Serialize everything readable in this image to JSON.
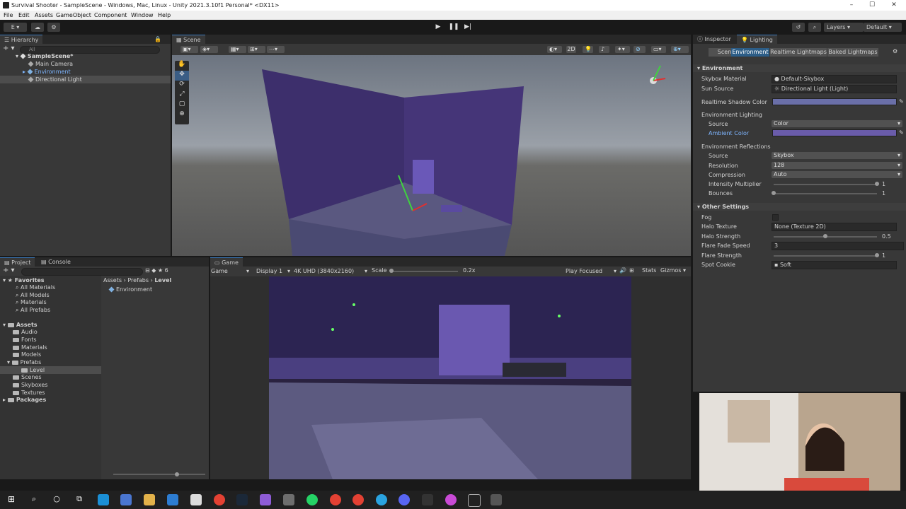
{
  "window": {
    "title": "Survival Shooter - SampleScene - Windows, Mac, Linux - Unity 2021.3.10f1 Personal* <DX11>"
  },
  "menu": [
    "File",
    "Edit",
    "Assets",
    "GameObject",
    "Component",
    "Window",
    "Help"
  ],
  "toolbar": {
    "account_label": "E",
    "layers_label": "Layers",
    "layout_label": "Default"
  },
  "hierarchy": {
    "tab": "Hierarchy",
    "search_placeholder": "All",
    "items": [
      {
        "label": "SampleScene*",
        "level": 0
      },
      {
        "label": "Main Camera",
        "level": 1
      },
      {
        "label": "Environment",
        "level": 1
      },
      {
        "label": "Directional Light",
        "level": 1
      }
    ]
  },
  "scene": {
    "tab": "Scene",
    "mode_2d": "2D"
  },
  "game": {
    "tab": "Game",
    "mode": "Game",
    "display": "Display 1",
    "resolution": "4K UHD (3840x2160)",
    "scale_label": "Scale",
    "scale_value": "0.2x",
    "play_focus": "Play Focused",
    "stats": "Stats",
    "gizmos": "Gizmos"
  },
  "project": {
    "tabs": [
      "Project",
      "Console"
    ],
    "hidden_count": "6",
    "breadcrumb": [
      "Assets",
      "Prefabs",
      "Level"
    ],
    "favorites_label": "Favorites",
    "favorites": [
      "All Materials",
      "All Models",
      "Materials",
      "All Prefabs"
    ],
    "assets_label": "Assets",
    "folders": [
      "Audio",
      "Fonts",
      "Materials",
      "Models",
      "Prefabs",
      "Level",
      "Scenes",
      "Skyboxes",
      "Textures"
    ],
    "packages_label": "Packages",
    "content_items": [
      "Environment"
    ]
  },
  "inspector": {
    "tabs": [
      "Inspector",
      "Lighting"
    ],
    "subtabs": [
      "Scene",
      "Environment",
      "Realtime Lightmaps",
      "Baked Lightmaps"
    ],
    "environment_header": "Environment",
    "skybox_label": "Skybox Material",
    "skybox_value": "Default-Skybox",
    "sun_label": "Sun Source",
    "sun_value": "Directional Light (Light)",
    "shadow_color_label": "Realtime Shadow Color",
    "env_lighting_label": "Environment Lighting",
    "source_label": "Source",
    "source_value": "Color",
    "ambient_label": "Ambient Color",
    "env_reflections_label": "Environment Reflections",
    "refl_source_label": "Source",
    "refl_source_value": "Skybox",
    "resolution_label": "Resolution",
    "resolution_value": "128",
    "compression_label": "Compression",
    "compression_value": "Auto",
    "intensity_label": "Intensity Multiplier",
    "intensity_value": "1",
    "intensity_fraction": 1.0,
    "bounces_label": "Bounces",
    "bounces_value": "1",
    "bounces_fraction": 0.0,
    "other_header": "Other Settings",
    "fog_label": "Fog",
    "halo_texture_label": "Halo Texture",
    "halo_texture_value": "None (Texture 2D)",
    "halo_strength_label": "Halo Strength",
    "halo_strength_value": "0.5",
    "halo_strength_fraction": 0.5,
    "flare_fade_label": "Flare Fade Speed",
    "flare_fade_value": "3",
    "flare_strength_label": "Flare Strength",
    "flare_strength_value": "1",
    "flare_strength_fraction": 1.0,
    "spot_cookie_label": "Spot Cookie",
    "spot_cookie_value": "Soft"
  },
  "colors": {
    "shadow_color": "#6a6fa8",
    "ambient_color": "#6a5caa",
    "selection": "#2c5d87",
    "accent": "#3a79bb"
  }
}
